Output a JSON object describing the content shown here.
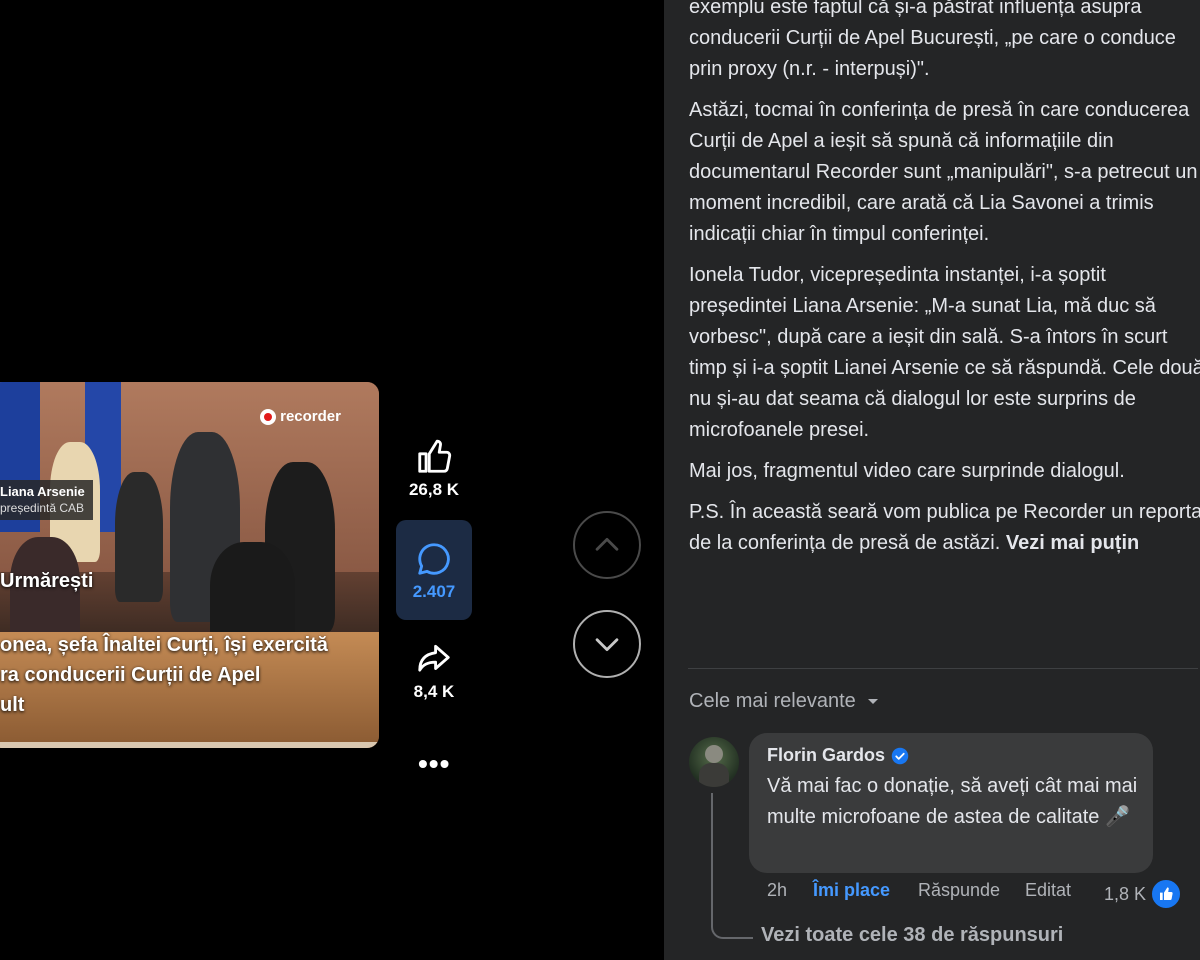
{
  "video": {
    "brand": "recorder",
    "name_tag": "Liana Arsenie",
    "name_role": "președintă CAB",
    "caption_line1": "Urmărești",
    "caption_line2": "onea, șefa Înaltei Curți, își exercită",
    "caption_line3": "ra conducerii Curții de Apel",
    "caption_line4": "ult"
  },
  "actions": {
    "likes": "26,8 K",
    "comments": "2.407",
    "shares": "8,4 K",
    "more": "•••"
  },
  "post": {
    "p1": "exemplu este faptul că și-a păstrat influența asupra conducerii Curții de Apel București, „pe care o conduce prin proxy (n.r. - interpuși)\".",
    "p2": "Astăzi, tocmai în conferința de presă în care conducerea Curții de Apel a ieșit să spună că informațiile din documentarul Recorder sunt „manipulări\", s-a petrecut un moment incredibil, care arată că Lia Savonei a trimis indicații chiar în timpul conferinței.",
    "p3": "Ionela Tudor, vicepreședinta instanței, i-a șoptit președintei Liana Arsenie: „M-a sunat Lia, mă duc să vorbesc\", după care a ieșit din sală. S-a întors în scurt timp și i-a șoptit Lianei Arsenie ce să răspundă. Cele două nu și-au dat seama că dialogul lor este surprins de microfoanele presei.",
    "p4": "Mai jos, fragmentul video care surprinde dialogul.",
    "p5": "P.S. În această seară vom publica pe Recorder un reportaj de la conferința de presă de astăzi. ",
    "see_less": "Vezi mai puțin"
  },
  "comments_section": {
    "sort_label": "Cele mai relevante",
    "comment": {
      "author": "Florin Gardos",
      "text": "Vă mai fac o donație, să aveți cât mai mai multe microfoane de astea de calitate 🎤",
      "time": "2h",
      "like_label": "Îmi place",
      "reply_label": "Răspunde",
      "edited_label": "Editat",
      "reaction_count": "1,8 K"
    },
    "view_replies": "Vezi toate cele 38 de răspunsuri"
  },
  "colors": {
    "accent": "#4599ff",
    "panel_bg": "#242526",
    "bubble_bg": "#3a3b3c",
    "like_blue": "#1877f2"
  }
}
